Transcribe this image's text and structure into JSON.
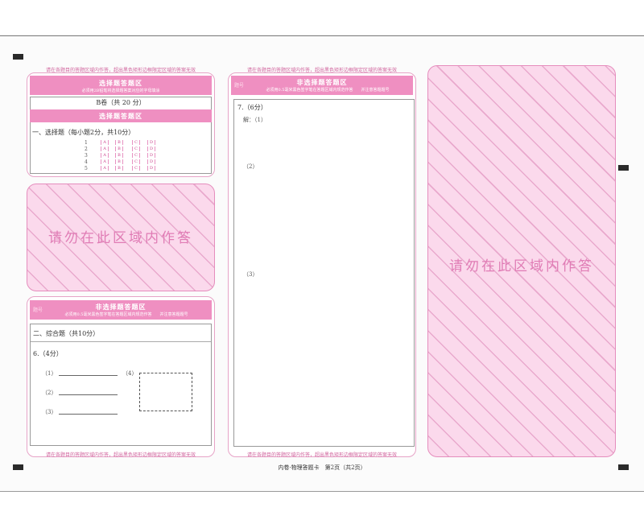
{
  "warnings": {
    "top": "请在各题目的答题区域内作答，超出黑色矩形边框限定区域的答案无效",
    "bottom": "请在各题目的答题区域内作答，超出黑色矩形边框限定区域的答案无效"
  },
  "choice_section": {
    "header_title": "选择题答题区",
    "header_subtitle": "必须用2B铅笔将选择题答案对应的字母填涂",
    "volume_label": "B卷（共 20 分）",
    "sub_bar_title": "选择题答题区",
    "question_heading": "一、选择题（每小题2分，共10分）",
    "rows": [
      {
        "num": "1",
        "options": [
          "A",
          "B",
          "C",
          "D"
        ]
      },
      {
        "num": "2",
        "options": [
          "A",
          "B",
          "C",
          "D"
        ]
      },
      {
        "num": "3",
        "options": [
          "A",
          "B",
          "C",
          "D"
        ]
      },
      {
        "num": "4",
        "options": [
          "A",
          "B",
          "C",
          "D"
        ]
      },
      {
        "num": "5",
        "options": [
          "A",
          "B",
          "C",
          "D"
        ]
      }
    ]
  },
  "no_answer_text": "请勿在此区域内作答",
  "non_choice_left": {
    "header_title": "非选择题答题区",
    "header_label": "题号",
    "header_subtitle": "必须用0.5毫米黑色签字笔在答题区域内规范作答　　并注意答题题号",
    "section_heading": "二、综合题（共10分）",
    "question": "6.（4分）",
    "item1": "（1）",
    "item2": "（2）",
    "item3": "（3）",
    "item4": "（4）"
  },
  "non_choice_mid": {
    "header_title": "非选择题答题区",
    "header_label": "题号",
    "header_subtitle": "必须用0.5毫米黑色签字笔在答题区域内规范作答　　并注意答题题号",
    "question": "7.（6分）",
    "answer_prefix": "解：（1）",
    "item2": "（2）",
    "item3": "（3）"
  },
  "footer": "内卷·物理答题卡　第2页（共2页）"
}
